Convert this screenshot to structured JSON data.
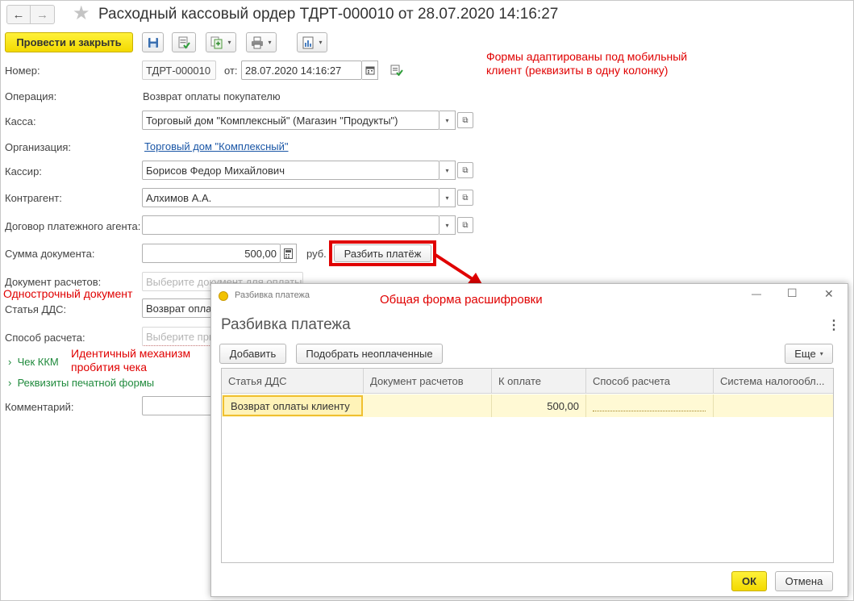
{
  "window": {
    "title": "Расходный кассовый ордер ТДРТ-000010 от 28.07.2020 14:16:27",
    "nav_back": "←",
    "nav_forward": "→",
    "star": "★"
  },
  "toolbar": {
    "post_and_close": "Провести и закрыть",
    "dropdown_caret": "▾"
  },
  "form": {
    "number_label": "Номер:",
    "number_value": "ТДРТ-000010",
    "date_prefix": "от:",
    "date_value": "28.07.2020 14:16:27",
    "operation_label": "Операция:",
    "operation_value": "Возврат оплаты покупателю",
    "kassa_label": "Касса:",
    "kassa_value": "Торговый дом \"Комплексный\" (Магазин \"Продукты\")",
    "org_label": "Организация:",
    "org_value": "Торговый дом \"Комплексный\"",
    "cashier_label": "Кассир:",
    "cashier_value": "Борисов Федор Михайлович",
    "counterparty_label": "Контрагент:",
    "counterparty_value": "Алхимов А.А.",
    "agent_contract_label": "Договор платежного агента:",
    "agent_contract_value": "",
    "amount_label": "Сумма документа:",
    "amount_value": "500,00",
    "currency": "руб.",
    "split_button": "Разбить платёж",
    "settlement_doc_label": "Документ расчетов:",
    "settlement_doc_placeholder": "Выберите документ для оплаты",
    "dds_label": "Статья ДДС:",
    "dds_value": "Возврат опла",
    "payment_method_label": "Способ расчета:",
    "payment_method_placeholder": "Выберите при",
    "kkm_group": "Чек ККМ",
    "print_group": "Реквизиты печатной формы",
    "comment_label": "Комментарий:"
  },
  "annotations": {
    "mobile": "Формы адаптированы под мобильный клиент (реквизиты в одну колонку)",
    "single_doc": "Однострочный документ",
    "same_mechanism": "Идентичный механизм пробития чека",
    "common_form": "Общая форма расшифровки",
    "color": "#e00000"
  },
  "dialog": {
    "window_title": "Разбивка платежа",
    "heading": "Разбивка платежа",
    "more": "⋮",
    "minimize": "—",
    "maximize": "☐",
    "close": "✕",
    "add_button": "Добавить",
    "pick_unpaid_button": "Подобрать неоплаченные",
    "more_button": "Еще",
    "columns": [
      "Статья ДДС",
      "Документ расчетов",
      "К оплате",
      "Способ расчета",
      "Система налогообл..."
    ],
    "rows": [
      {
        "dds": "Возврат оплаты клиенту",
        "doc": "",
        "amount": "500,00",
        "method": "",
        "tax": ""
      }
    ],
    "ok_button": "ОК",
    "cancel_button": "Отмена"
  },
  "colors": {
    "accent_yellow": "#f3d900",
    "highlight_row": "#fff9d4",
    "link_blue": "#1a56a6",
    "group_green": "#1f8a3c",
    "annotation_red": "#e00000"
  }
}
